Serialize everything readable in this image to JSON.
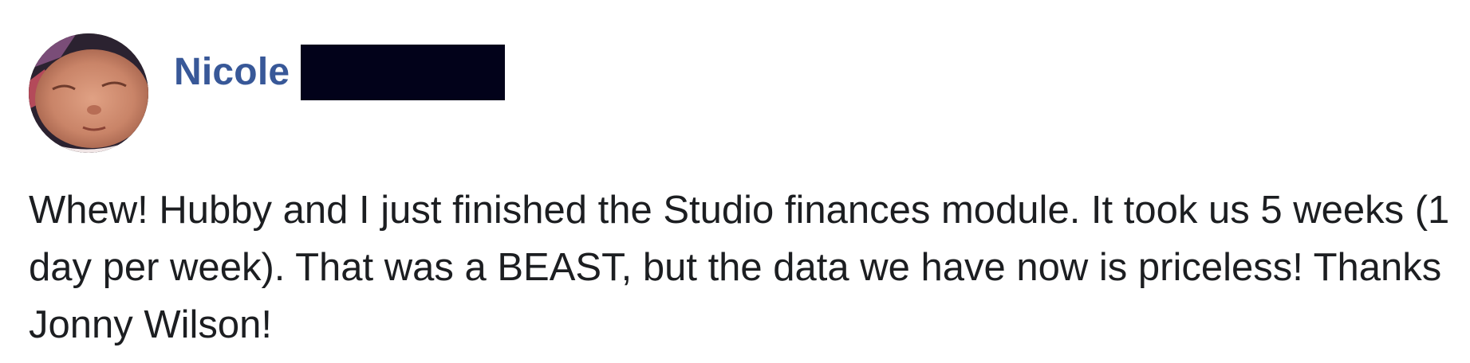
{
  "comment": {
    "author": {
      "first_name": "Nicole",
      "avatar_icon": "sleeping-baby-photo",
      "last_name_redacted": true
    },
    "text": "Whew! Hubby and I just finished the Studio finances module. It took us 5 weeks (1 day per week). That was a BEAST, but the data we have now is priceless! Thanks Jonny Wilson!"
  },
  "colors": {
    "author_name": "#385898",
    "body_text": "#1c1e21",
    "redaction_box": "#02021a",
    "background": "#ffffff"
  }
}
